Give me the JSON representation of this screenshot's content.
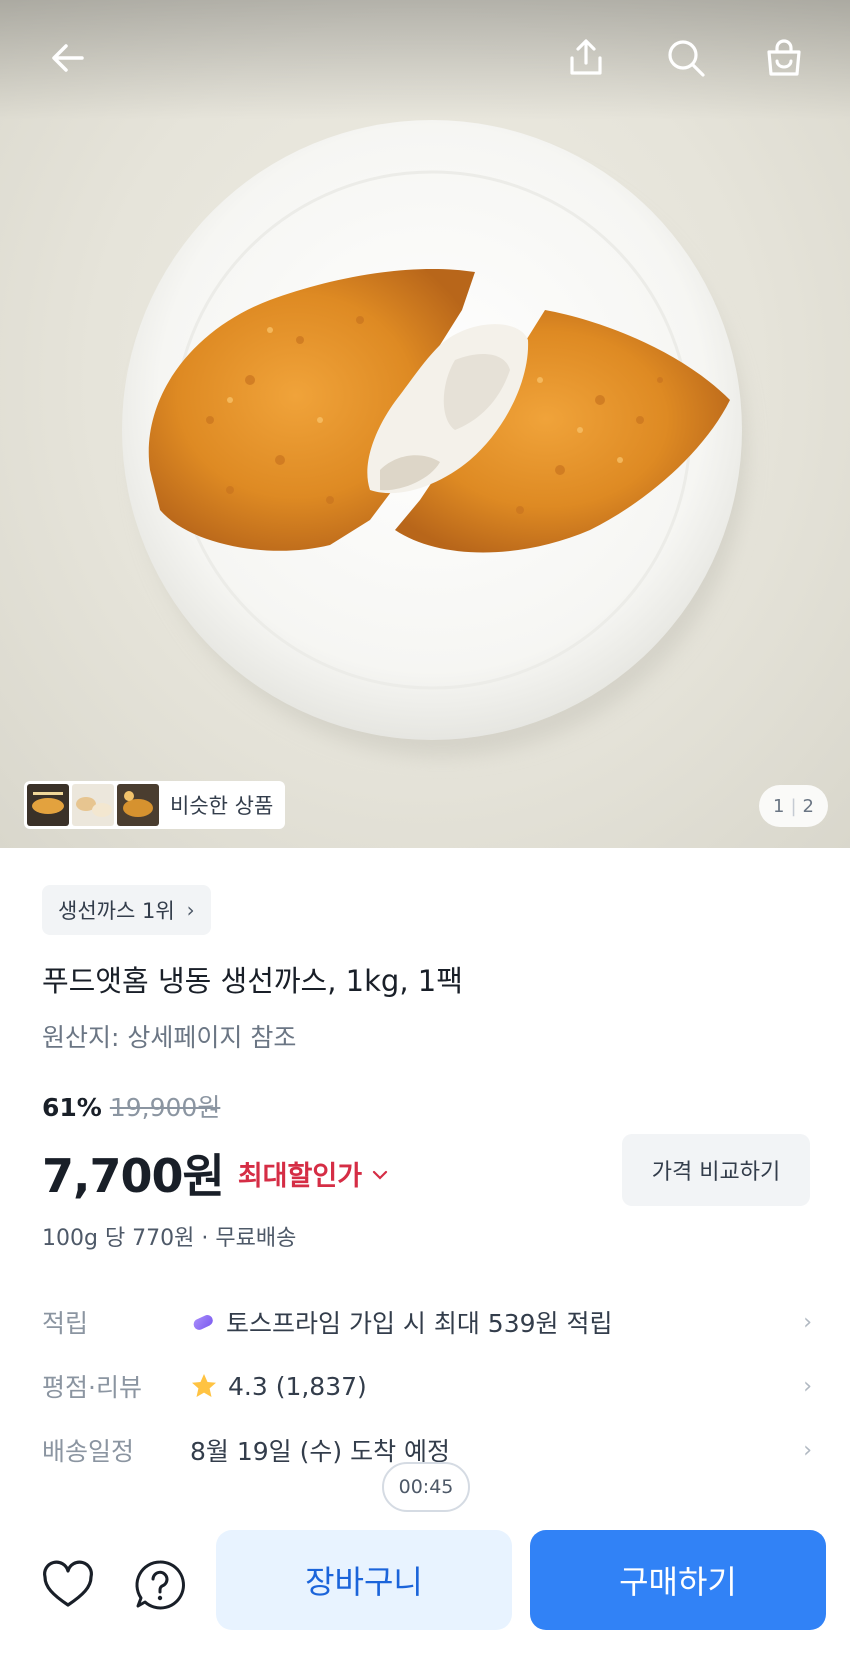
{
  "hero": {
    "image_icon": "fried-fish-cutlet-photo",
    "similar_label": "비슷한 상품",
    "pager_current": "1",
    "pager_total": "2"
  },
  "topbar": {
    "icons": [
      "back-arrow-icon",
      "share-icon",
      "search-icon",
      "shopping-bag-icon"
    ]
  },
  "product": {
    "rank_badge": "생선까스 1위",
    "title": "푸드앳홈 냉동 생선까스, 1kg, 1팩",
    "origin": "원산지: 상세페이지 참조",
    "discount_rate": "61%",
    "original_price": "19,900원",
    "price": "7,700원",
    "max_discount_label": "최대할인가",
    "compare_button": "가격 비교하기",
    "unit_price": "100g 당 770원 · 무료배송"
  },
  "info_rows": [
    {
      "label": "적립",
      "value": "토스프라임 가입 시 최대 539원 적립",
      "icon": "toss-prime-icon"
    },
    {
      "label": "평점·리뷰",
      "value": "4.3 (1,837)",
      "icon": "star-icon"
    },
    {
      "label": "배송일정",
      "value": "8월 19일 (수) 도착 예정"
    }
  ],
  "timer": "00:45",
  "bottom_bar": {
    "cart_button": "장바구니",
    "buy_button": "구매하기",
    "icons": [
      "heart-icon",
      "help-icon"
    ]
  },
  "colors": {
    "primary": "#3182f6",
    "cart_bg": "#e8f3ff",
    "discount_red": "#d52d45",
    "star": "#ffc342"
  }
}
